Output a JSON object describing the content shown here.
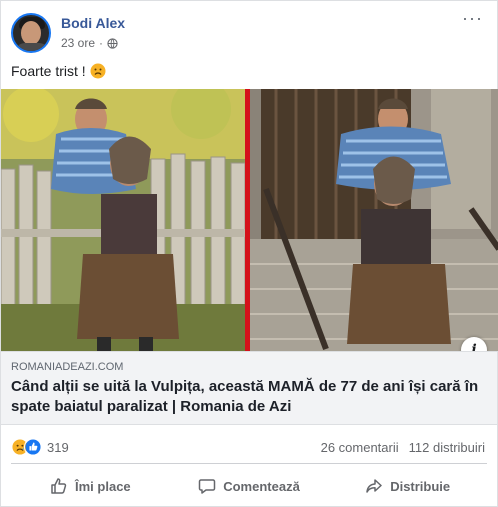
{
  "post": {
    "author": "Bodi Alex",
    "time": "23 ore",
    "separator": "·",
    "text": "Foarte trist !"
  },
  "icons": {
    "more": "more-options-icon",
    "globe": "globe-icon",
    "sad": "sad-face-emoji",
    "info": "info-icon",
    "like": "thumbs-up-icon",
    "comment": "comment-bubble-icon",
    "share": "share-arrow-icon"
  },
  "link": {
    "domain": "ROMANIADEAZI.COM",
    "title": "Când alții se uită la Vulpița, această MAMĂ de 77 de ani își cară în spate baiatul paralizat | Romania de Azi",
    "info_label": "i"
  },
  "reactions": {
    "count": "319",
    "comments": "26 comentarii",
    "shares": "112 distribuiri"
  },
  "actions": {
    "like": "Îmi place",
    "comment": "Comentează",
    "share": "Distribuie"
  },
  "colors": {
    "author_link": "#385898",
    "like_blue": "#1877f2",
    "sad_yellow": "#f7b125",
    "muted": "#65676b"
  }
}
